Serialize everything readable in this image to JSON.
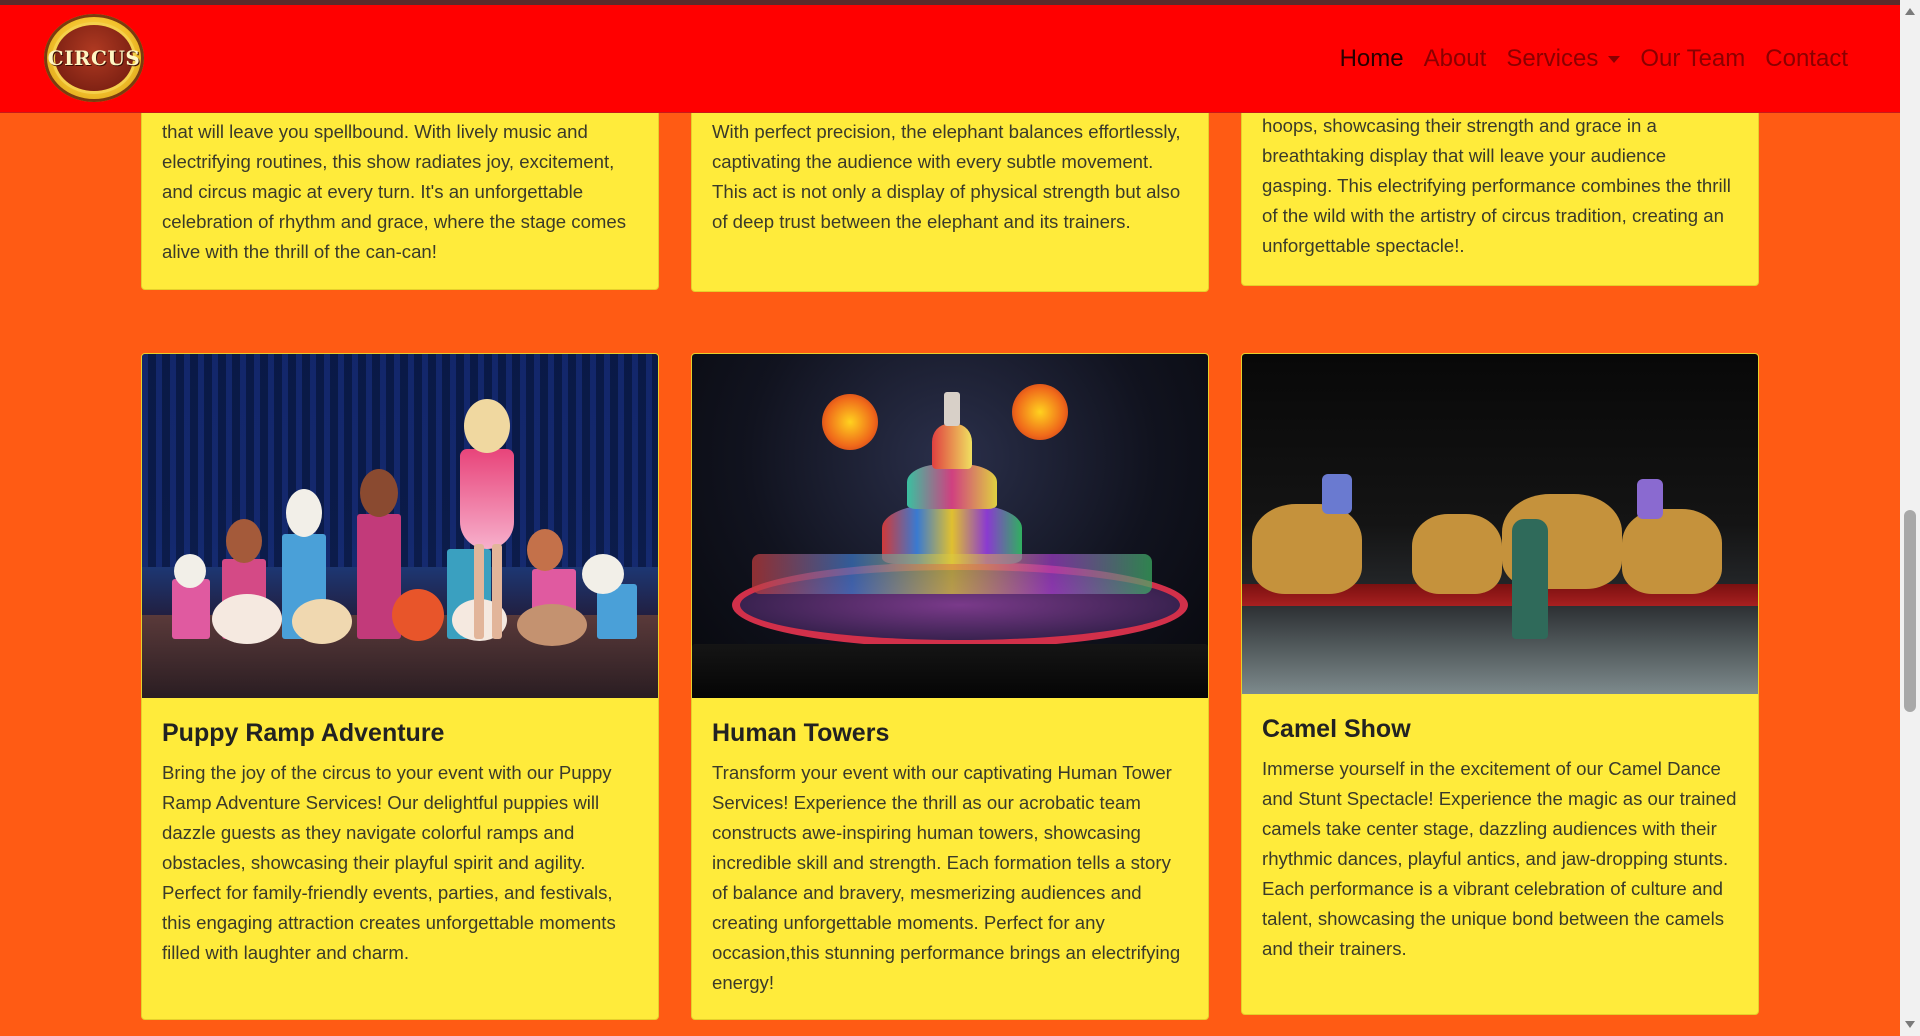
{
  "nav": {
    "logo_text": "CIRCUS",
    "links": [
      "Home",
      "About",
      "Services",
      "Our Team",
      "Contact"
    ]
  },
  "top_cards": [
    {
      "text": "that will leave you spellbound. With lively music and electrifying routines, this show radiates joy, excitement, and circus magic at every turn. It's an unforgettable celebration of rhythm and grace, where the stage comes alive with the thrill of the can-can!"
    },
    {
      "text": "With perfect precision, the elephant balances effortlessly, captivating the audience with every subtle movement. This act is not only a display of physical strength but also of deep trust between the elephant and its trainers."
    },
    {
      "text": "hoops, showcasing their strength and grace in a breathtaking display that will leave your audience gasping. This electrifying performance combines the thrill of the wild with the artistry of circus tradition, creating an unforgettable spectacle!."
    }
  ],
  "cards": [
    {
      "title": "Puppy Ramp Adventure",
      "text": "Bring the joy of the circus to your event with our Puppy Ramp Adventure Services! Our delightful puppies will dazzle guests as they navigate colorful ramps and obstacles, showcasing their playful spirit and agility. Perfect for family-friendly events, parties, and festivals, this engaging attraction creates unforgettable moments filled with laughter and charm."
    },
    {
      "title": "Human Towers",
      "text": "Transform your event with our captivating Human Tower Services! Experience the thrill as our acrobatic team constructs awe-inspiring human towers, showcasing incredible skill and strength. Each formation tells a story of balance and bravery, mesmerizing audiences and creating unforgettable moments. Perfect for any occasion,this stunning performance brings an electrifying energy!"
    },
    {
      "title": "Camel Show",
      "text": "Immerse yourself in the excitement of our Camel Dance and Stunt Spectacle! Experience the magic as our trained camels take center stage, dazzling audiences with their rhythmic dances, playful antics, and jaw-dropping stunts. Each performance is a vibrant celebration of culture and talent, showcasing the unique bond between the camels and their trainers."
    }
  ]
}
